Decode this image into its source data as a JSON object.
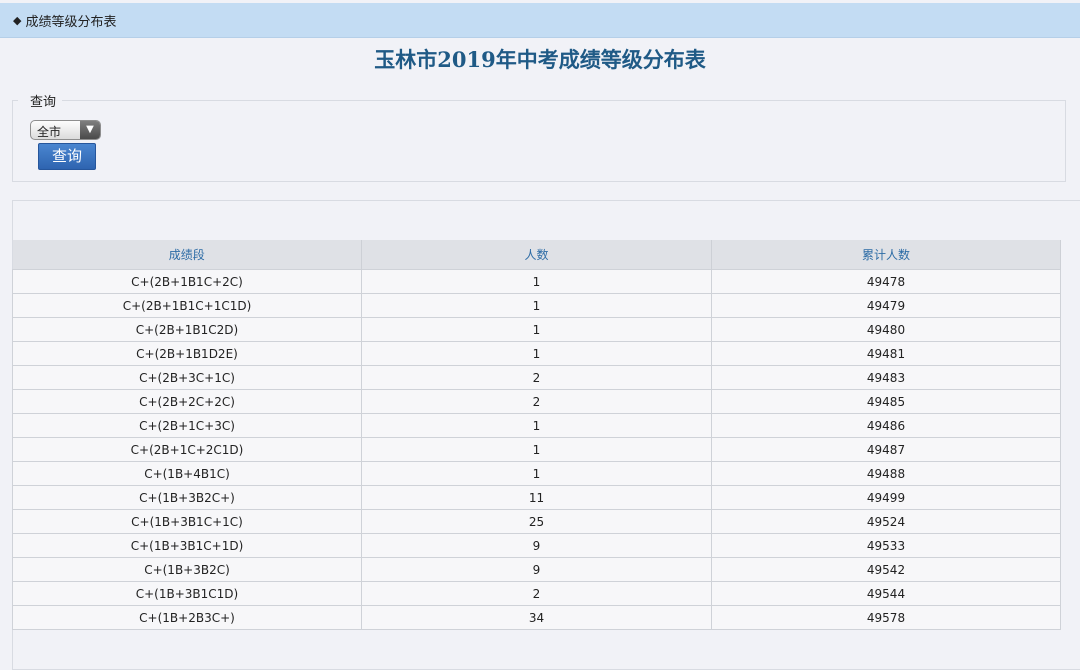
{
  "nav": {
    "breadcrumb_icon": "diamond-bullet-icon",
    "breadcrumb": "成绩等级分布表"
  },
  "page": {
    "title": "玉林市2019年中考成绩等级分布表"
  },
  "query": {
    "legend": "查询",
    "region_selected": "全市",
    "submit_label": "查询"
  },
  "table": {
    "headers": [
      "成绩段",
      "人数",
      "累计人数"
    ],
    "rows": [
      [
        "C+(2B+1B1C+2C)",
        "1",
        "49478"
      ],
      [
        "C+(2B+1B1C+1C1D)",
        "1",
        "49479"
      ],
      [
        "C+(2B+1B1C2D)",
        "1",
        "49480"
      ],
      [
        "C+(2B+1B1D2E)",
        "1",
        "49481"
      ],
      [
        "C+(2B+3C+1C)",
        "2",
        "49483"
      ],
      [
        "C+(2B+2C+2C)",
        "2",
        "49485"
      ],
      [
        "C+(2B+1C+3C)",
        "1",
        "49486"
      ],
      [
        "C+(2B+1C+2C1D)",
        "1",
        "49487"
      ],
      [
        "C+(1B+4B1C)",
        "1",
        "49488"
      ],
      [
        "C+(1B+3B2C+)",
        "11",
        "49499"
      ],
      [
        "C+(1B+3B1C+1C)",
        "25",
        "49524"
      ],
      [
        "C+(1B+3B1C+1D)",
        "9",
        "49533"
      ],
      [
        "C+(1B+3B2C)",
        "9",
        "49542"
      ],
      [
        "C+(1B+3B1C1D)",
        "2",
        "49544"
      ],
      [
        "C+(1B+2B3C+)",
        "34",
        "49578"
      ]
    ]
  }
}
